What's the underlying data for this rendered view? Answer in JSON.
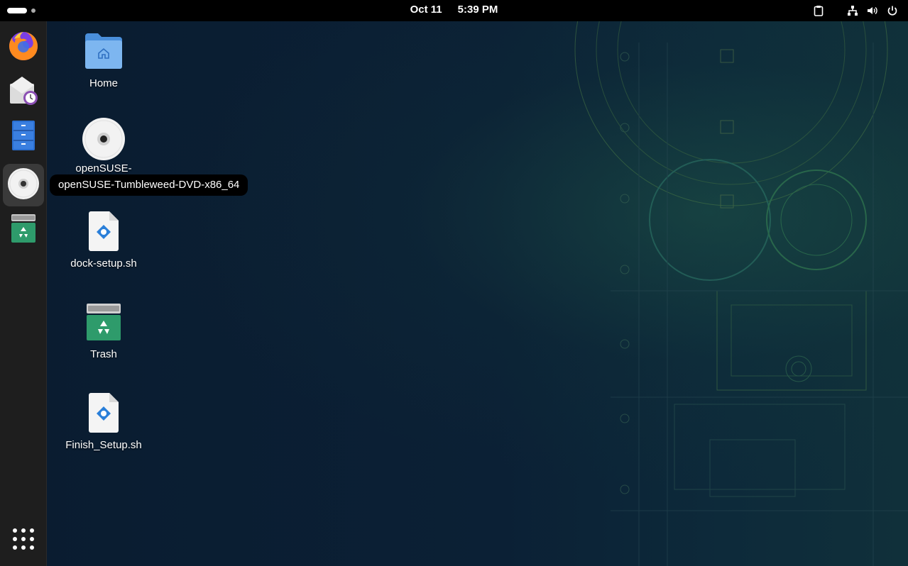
{
  "topbar": {
    "date": "Oct 11",
    "time": "5:39 PM",
    "tray_icons": [
      "clipboard-icon",
      "network-icon",
      "volume-icon",
      "power-icon"
    ]
  },
  "dock": {
    "items": [
      {
        "name": "firefox",
        "icon": "firefox-icon"
      },
      {
        "name": "mail-scheduler",
        "icon": "mail-clock-icon"
      },
      {
        "name": "file-cabinet",
        "icon": "files-icon"
      },
      {
        "name": "dvd",
        "icon": "disc-icon",
        "active": true
      },
      {
        "name": "trash",
        "icon": "trash-icon"
      }
    ],
    "app_grid_icon": "app-grid-icon"
  },
  "tooltip": "openSUSE-Tumbleweed-DVD-x86_64",
  "desktop": {
    "icons": [
      {
        "label": "Home",
        "icon": "home-folder-icon"
      },
      {
        "label": "openSUSE-",
        "icon": "disc-icon"
      },
      {
        "label": "dock-setup.sh",
        "icon": "script-file-icon"
      },
      {
        "label": "Trash",
        "icon": "trash-icon"
      },
      {
        "label": "Finish_Setup.sh",
        "icon": "script-file-icon"
      }
    ]
  },
  "colors": {
    "topbar": "#000000",
    "dock": "#1e1e1e",
    "wallpaper": "#0b1f33",
    "accent_green": "#2e9b6b",
    "folder_blue": "#6aa9ea"
  }
}
